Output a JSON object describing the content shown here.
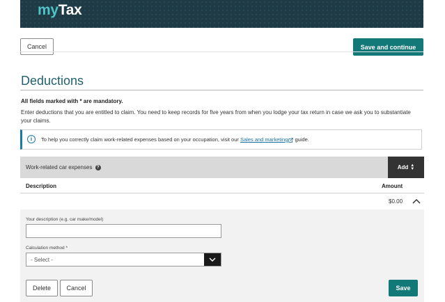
{
  "header": {
    "logo_prefix": "my",
    "logo_suffix": "Tax"
  },
  "toolbar": {
    "cancel_label": "Cancel",
    "save_continue_label": "Save and continue"
  },
  "page": {
    "title": "Deductions",
    "mandatory_note": "All fields marked with * are mandatory.",
    "intro": "Enter deductions that you are entitled to claim. You need to keep records for five years from when you lodge your tax return in case we ask you to substantiate your claims."
  },
  "info": {
    "text_before": "To help you correctly claim work-related expenses based on your occupation, visit our ",
    "link_text": "Sales and marketing",
    "text_after": " guide."
  },
  "section": {
    "title": "Work-related car expenses",
    "add_label": "Add"
  },
  "table": {
    "col_description": "Description",
    "col_amount": "Amount",
    "amount_value": "$0.00"
  },
  "form": {
    "description_label": "Your description (e.g. car make/model)",
    "description_value": "",
    "method_label": "Calculation method *",
    "method_selected": "- Select -",
    "delete_label": "Delete",
    "cancel_label": "Cancel",
    "save_label": "Save"
  },
  "colors": {
    "brand_teal": "#137878",
    "header_bg": "#1f3b45",
    "title_color": "#22606d",
    "info_accent": "#1a7ba3"
  }
}
